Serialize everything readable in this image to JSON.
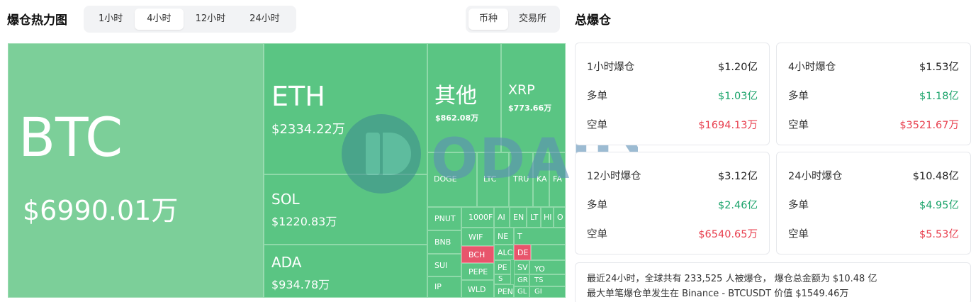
{
  "heatmap": {
    "title": "爆仓热力图",
    "time_tabs": [
      {
        "label": "1小时",
        "active": false
      },
      {
        "label": "4小时",
        "active": true
      },
      {
        "label": "12小时",
        "active": false
      },
      {
        "label": "24小时",
        "active": false
      }
    ],
    "category_tabs": [
      {
        "label": "币种",
        "active": true
      },
      {
        "label": "交易所",
        "active": false
      }
    ],
    "cells": {
      "btc": {
        "symbol": "BTC",
        "value": "$6990.01万"
      },
      "eth": {
        "symbol": "ETH",
        "value": "$2334.22万"
      },
      "sol": {
        "symbol": "SOL",
        "value": "$1220.83万"
      },
      "ada": {
        "symbol": "ADA",
        "value": "$934.78万"
      },
      "other": {
        "symbol": "其他",
        "value": "$862.08万"
      },
      "xrp": {
        "symbol": "XRP",
        "value": "$773.66万"
      },
      "doge": {
        "symbol": "DOGE"
      },
      "ltc": {
        "symbol": "LTC"
      },
      "tru": {
        "symbol": "TRU"
      },
      "ka": {
        "symbol": "KA"
      },
      "fa": {
        "symbol": "FA"
      },
      "pnut": {
        "symbol": "PNUT"
      },
      "k1000": {
        "symbol": "1000F"
      },
      "ai": {
        "symbol": "AI"
      },
      "en": {
        "symbol": "EN"
      },
      "lt": {
        "symbol": "LT"
      },
      "hi": {
        "symbol": "HI"
      },
      "o": {
        "symbol": "O"
      },
      "bnb": {
        "symbol": "BNB"
      },
      "wif": {
        "symbol": "WIF"
      },
      "ne": {
        "symbol": "NE"
      },
      "t": {
        "symbol": "T"
      },
      "bch": {
        "symbol": "BCH"
      },
      "alc": {
        "symbol": "ALC"
      },
      "de": {
        "symbol": "DE"
      },
      "sui": {
        "symbol": "SUI"
      },
      "pepe": {
        "symbol": "PEPE"
      },
      "pe": {
        "symbol": "PE"
      },
      "sv": {
        "symbol": "SV"
      },
      "yo": {
        "symbol": "YO"
      },
      "ts": {
        "symbol": "TS"
      },
      "ip": {
        "symbol": "IP"
      },
      "s": {
        "symbol": "S"
      },
      "gr": {
        "symbol": "GR"
      },
      "wld": {
        "symbol": "WLD"
      },
      "pen": {
        "symbol": "PEN"
      },
      "gl": {
        "symbol": "GL"
      },
      "gi": {
        "symbol": "GI"
      }
    }
  },
  "totals": {
    "title": "总爆仓",
    "cards": [
      {
        "period": "1小时爆仓",
        "total": "$1.20亿",
        "long_label": "多单",
        "long": "$1.03亿",
        "short_label": "空单",
        "short": "$1694.13万"
      },
      {
        "period": "4小时爆仓",
        "total": "$1.53亿",
        "long_label": "多单",
        "long": "$1.18亿",
        "short_label": "空单",
        "short": "$3521.67万"
      },
      {
        "period": "12小时爆仓",
        "total": "$3.12亿",
        "long_label": "多单",
        "long": "$2.46亿",
        "short_label": "空单",
        "short": "$6540.65万"
      },
      {
        "period": "24小时爆仓",
        "total": "$10.48亿",
        "long_label": "多单",
        "long": "$4.95亿",
        "short_label": "空单",
        "short": "$5.53亿"
      }
    ],
    "summary_line1": "最近24小时，全球共有 233,525 人被爆仓， 爆仓总金额为 $10.48 亿",
    "summary_line2": "最大单笔爆仓单发生在 Binance - BTCUSDT 价值 $1549.46万"
  },
  "watermark": {
    "text": "ODAILY",
    "logo": "odaily-logo-icon"
  },
  "colors": {
    "long_green": "#1aa36a",
    "short_red": "#e8404f",
    "cell_green": "#5ac583",
    "cell_light_green": "#7ccf99",
    "cell_red": "#e8556c"
  }
}
